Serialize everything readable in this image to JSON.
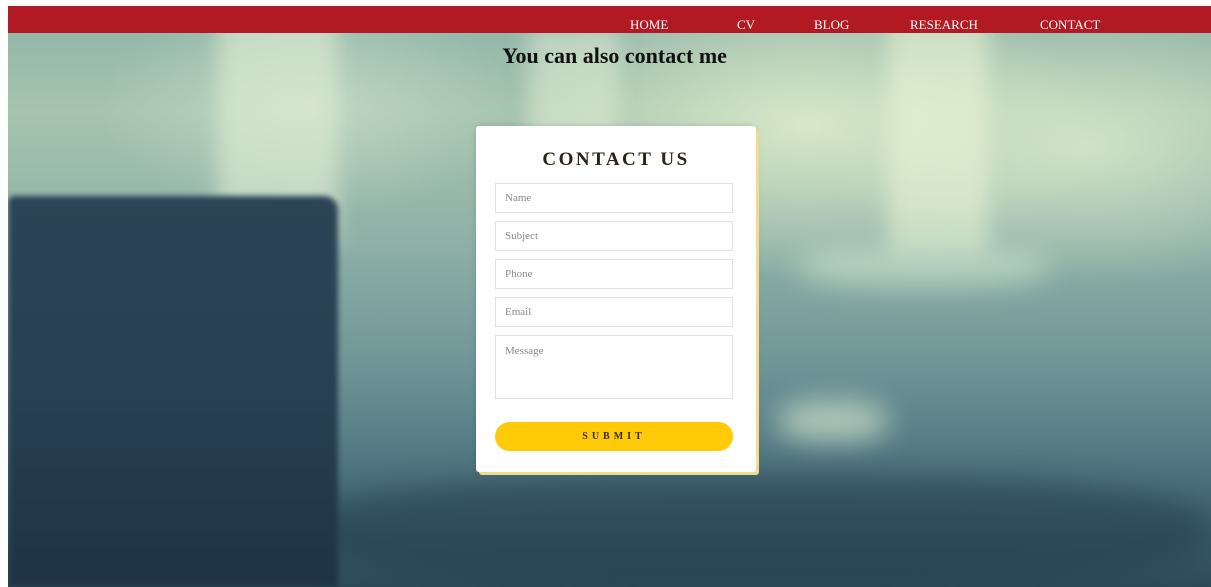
{
  "nav": {
    "items": [
      {
        "label": "HOME"
      },
      {
        "label": "CV"
      },
      {
        "label": "BLOG"
      },
      {
        "label": "RESEARCH"
      },
      {
        "label": "CONTACT"
      }
    ]
  },
  "heading": "You can also contact me",
  "form": {
    "title": "CONTACT US",
    "name_placeholder": "Name",
    "subject_placeholder": "Subject",
    "phone_placeholder": "Phone",
    "email_placeholder": "Email",
    "message_placeholder": "Message",
    "submit_label": "SUBMIT"
  },
  "colors": {
    "navbar": "#b11a22",
    "submit": "#ffcb08"
  }
}
